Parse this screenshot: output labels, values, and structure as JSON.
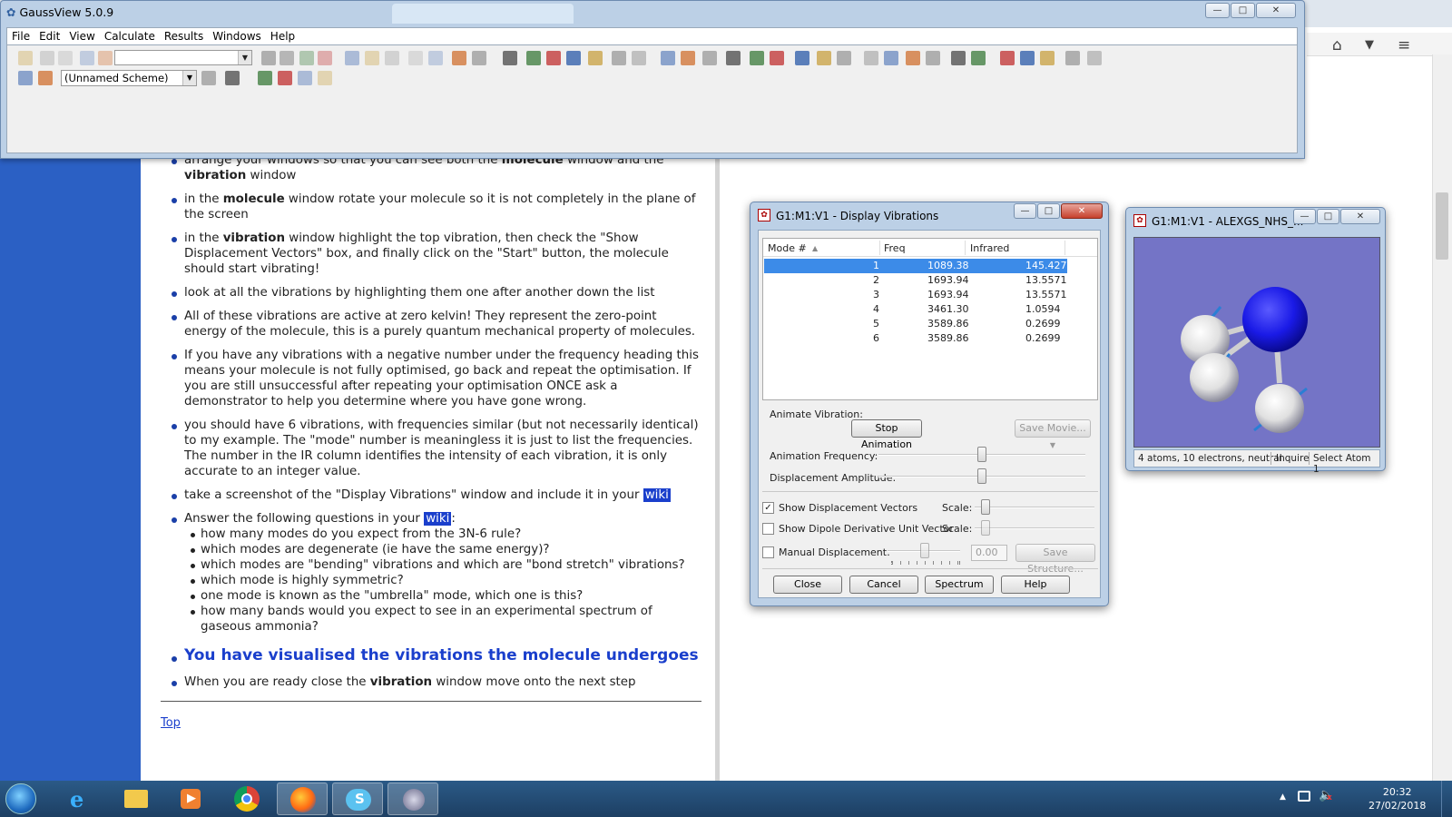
{
  "gaussview": {
    "title": "GaussView 5.0.9",
    "menu": [
      "File",
      "Edit",
      "View",
      "Calculate",
      "Results",
      "Windows",
      "Help"
    ],
    "scheme": "(Unnamed Scheme)",
    "window_controls": [
      "—",
      "□",
      "✕"
    ]
  },
  "browser": {
    "tools": [
      "⌂",
      "▼",
      "≡"
    ]
  },
  "wiki": {
    "bullets": [
      {
        "parts": [
          "arrange your windows so that you can see both the ",
          "molecule",
          " window and the ",
          "vibration",
          " window"
        ]
      },
      {
        "parts": [
          "in the ",
          "molecule",
          " window rotate your molecule so it is not completely in the plane of the screen"
        ]
      },
      {
        "parts": [
          "in the ",
          "vibration",
          " window highlight the top vibration, then check the \"Show Displacement Vectors\" box, and finally click on the \"Start\" button, the molecule should start vibrating!"
        ]
      },
      {
        "text": "look at all the vibrations by highlighting them one after another down the list"
      },
      {
        "text": "All of these vibrations are active at zero kelvin! They represent the zero-point energy of the molecule, this is a purely quantum mechanical property of molecules."
      },
      {
        "text": "If you have any vibrations with a negative number under the frequency heading this means your molecule is not fully optimised, go back and repeat the optimisation. If you are still unsuccessful after repeating your optimisation ONCE ask a demonstrator to help you determine where you have gone wrong."
      },
      {
        "text": "you should have 6 vibrations, with frequencies similar (but not necessarily identical) to my example. The \"mode\" number is meaningless it is just to list the frequencies. The number in the IR column identifies the intensity of each vibration, it is only accurate to an integer value."
      }
    ],
    "screenshot_text": "take a screenshot of the \"Display Vibrations\" window and include it in your ",
    "wiki_link": "wiki",
    "answer_text": "Answer the following questions in your ",
    "answer_colon": ":",
    "questions": [
      "how many modes do you expect from the 3N-6 rule?",
      "which modes are degenerate (ie have the same energy)?",
      "which modes are \"bending\" vibrations and which are \"bond stretch\" vibrations?",
      "which mode is highly symmetric?",
      "one mode is known as the \"umbrella\" mode, which one is this?",
      "how many bands would you expect to see in an experimental spectrum of gaseous ammonia?"
    ],
    "heading": "You have visualised the vibrations the molecule undergoes",
    "final": [
      "When you are ready close the ",
      "vibration",
      " window move onto the next step"
    ],
    "top_link": "Top"
  },
  "vibrations": {
    "title": "G1:M1:V1 - Display Vibrations",
    "columns": [
      "Mode #",
      "Freq",
      "Infrared"
    ],
    "rows": [
      {
        "mode": "1",
        "freq": "1089.38",
        "ir": "145.4275",
        "selected": true
      },
      {
        "mode": "2",
        "freq": "1693.94",
        "ir": "13.5571"
      },
      {
        "mode": "3",
        "freq": "1693.94",
        "ir": "13.5571"
      },
      {
        "mode": "4",
        "freq": "3461.30",
        "ir": "1.0594"
      },
      {
        "mode": "5",
        "freq": "3589.86",
        "ir": "0.2699"
      },
      {
        "mode": "6",
        "freq": "3589.86",
        "ir": "0.2699"
      }
    ],
    "animate_label": "Animate Vibration:",
    "stop_button": "Stop Animation",
    "save_movie": "Save Movie...",
    "anim_freq_label": "Animation Frequency:",
    "disp_amp_label": "Displacement Amplitude:",
    "anim_freq_level": 0.5,
    "disp_amp_level": 0.5,
    "show_vectors": "Show Displacement Vectors",
    "show_vectors_checked": true,
    "show_dipole": "Show Dipole Derivative Unit Vector",
    "scale_label": "Scale:",
    "manual_disp": "Manual Displacement:",
    "manual_value": "0.00",
    "save_structure": "Save Structure...",
    "buttons": [
      "Close",
      "Cancel",
      "Spectrum",
      "Help"
    ]
  },
  "molecule": {
    "title": "G1:M1:V1 - ALEXGS_NHS_...",
    "status": [
      "4 atoms, 10 electrons, neutral",
      "Inquire",
      "Select Atom 1"
    ],
    "colors": {
      "background": "#7474c6",
      "nitrogen": "#1a1ae6",
      "hydrogen": "#e8e8e8",
      "vector": "#2a7fd4"
    }
  },
  "taskbar": {
    "apps": [
      "start-orb",
      "internet-explorer-icon",
      "file-explorer-icon",
      "media-player-icon",
      "chrome-icon",
      "firefox-icon",
      "skype-icon",
      "gaussview-icon"
    ],
    "time": "20:32",
    "date": "27/02/2018"
  }
}
